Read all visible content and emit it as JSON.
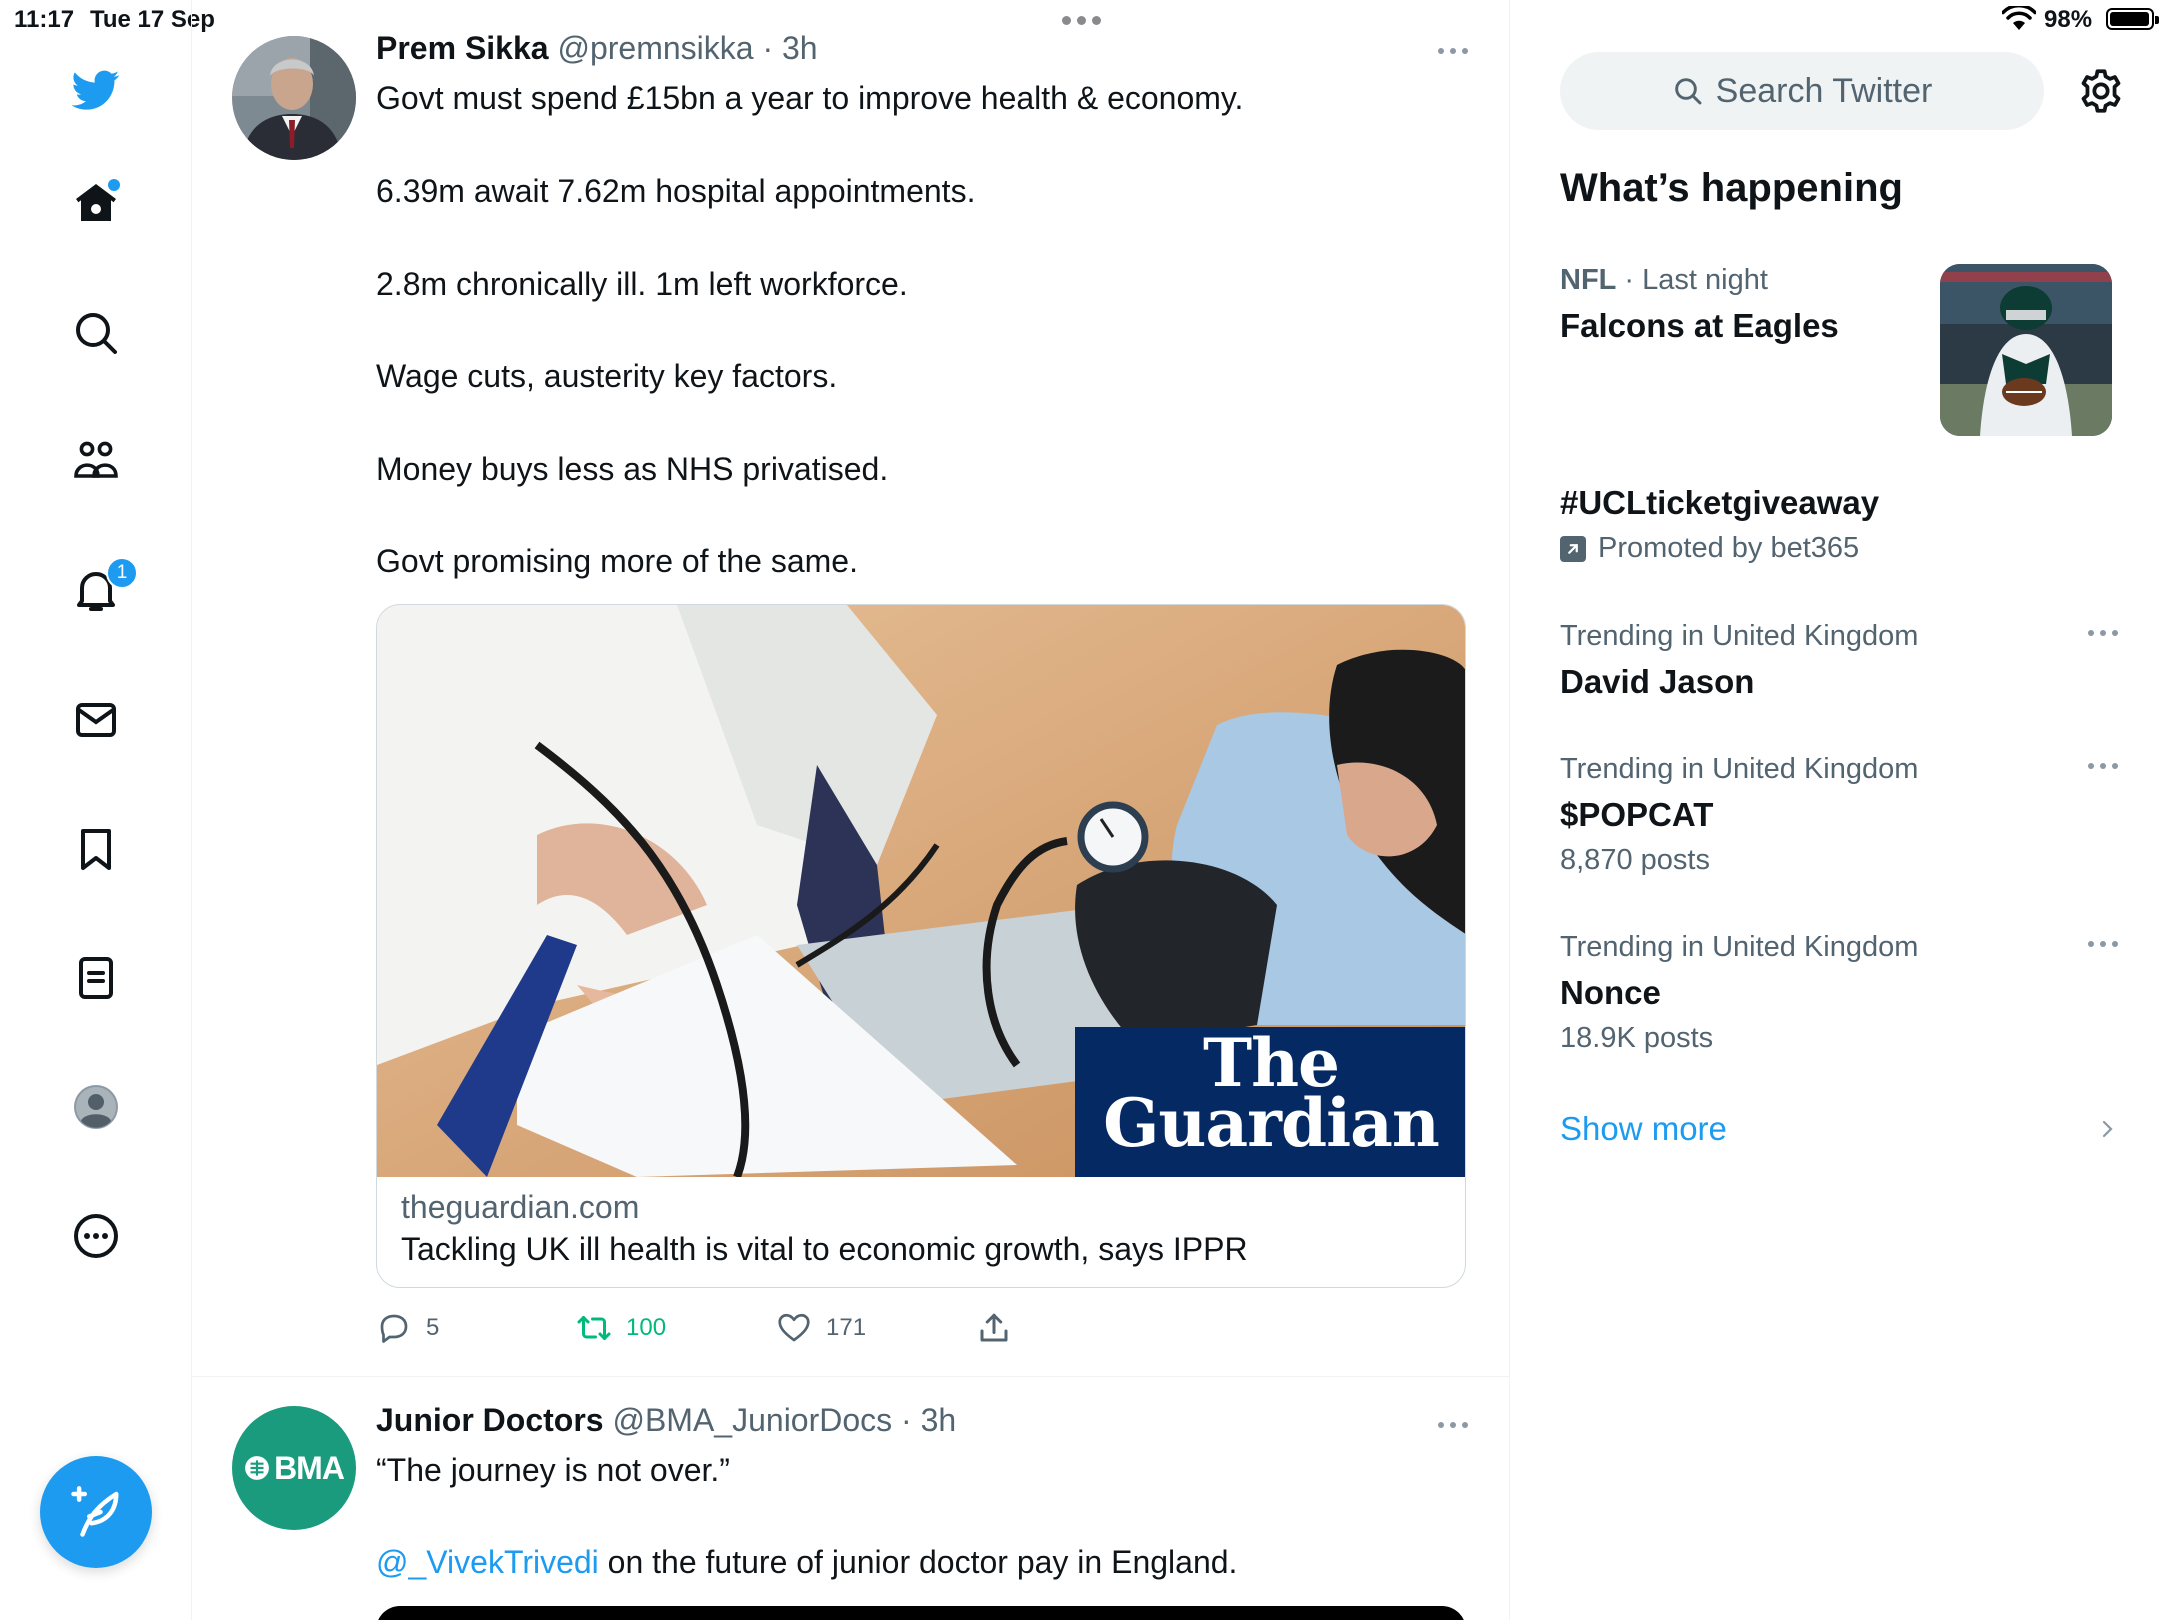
{
  "status_bar": {
    "time": "11:17",
    "date": "Tue 17 Sep",
    "battery_percent": "98%",
    "battery_level": 0.98
  },
  "nav": {
    "items": [
      "twitter-logo",
      "home-icon",
      "search-icon",
      "communities-icon",
      "notifications-icon",
      "messages-icon",
      "bookmarks-icon",
      "lists-icon",
      "profile-icon",
      "more-icon"
    ],
    "notifications_badge": "1",
    "compose_icon": "compose-feather-icon"
  },
  "tweets": [
    {
      "name": "Prem Sikka",
      "handle": "@premnsikka",
      "time": "· 3h",
      "lines": [
        "Govt must spend £15bn a year to improve health & economy.",
        "6.39m await 7.62m hospital appointments.",
        "2.8m chronically ill. 1m left workforce.",
        "Wage cuts, austerity key factors.",
        "Money buys less as NHS privatised.",
        "Govt promising more of the same."
      ],
      "card": {
        "image_logo_line1": "The",
        "image_logo_line2": "Guardian",
        "domain": "theguardian.com",
        "title": "Tackling UK ill health is vital to economic growth, says IPPR"
      },
      "actions": {
        "replies": "5",
        "retweets": "100",
        "likes": "171"
      }
    },
    {
      "name": "Junior Doctors",
      "handle": "@BMA_JuniorDocs",
      "time": "· 3h",
      "avatar_text": "BMA",
      "line1": "“The journey is not over.”",
      "mention": "@_VivekTrivedi",
      "line2_rest": " on the future of junior doctor pay in England."
    }
  ],
  "sidebar": {
    "search_placeholder": "Search Twitter",
    "heading": "What’s happening",
    "trends": [
      {
        "category": "NFL",
        "meta_rest": " · Last night",
        "name": "Falcons at Eagles"
      },
      {
        "name": "#UCLticketgiveaway",
        "promoted": "Promoted by bet365"
      },
      {
        "meta": "Trending in United Kingdom",
        "name": "David Jason"
      },
      {
        "meta": "Trending in United Kingdom",
        "name": "$POPCAT",
        "count": "8,870 posts"
      },
      {
        "meta": "Trending in United Kingdom",
        "name": "Nonce",
        "count": "18.9K posts"
      }
    ],
    "show_more": "Show more"
  },
  "colors": {
    "accent": "#1d9bf0",
    "retweet_green": "#00ba7c",
    "secondary_text": "#536471",
    "guardian_blue": "#052962",
    "bma_green": "#1a9b7e"
  }
}
